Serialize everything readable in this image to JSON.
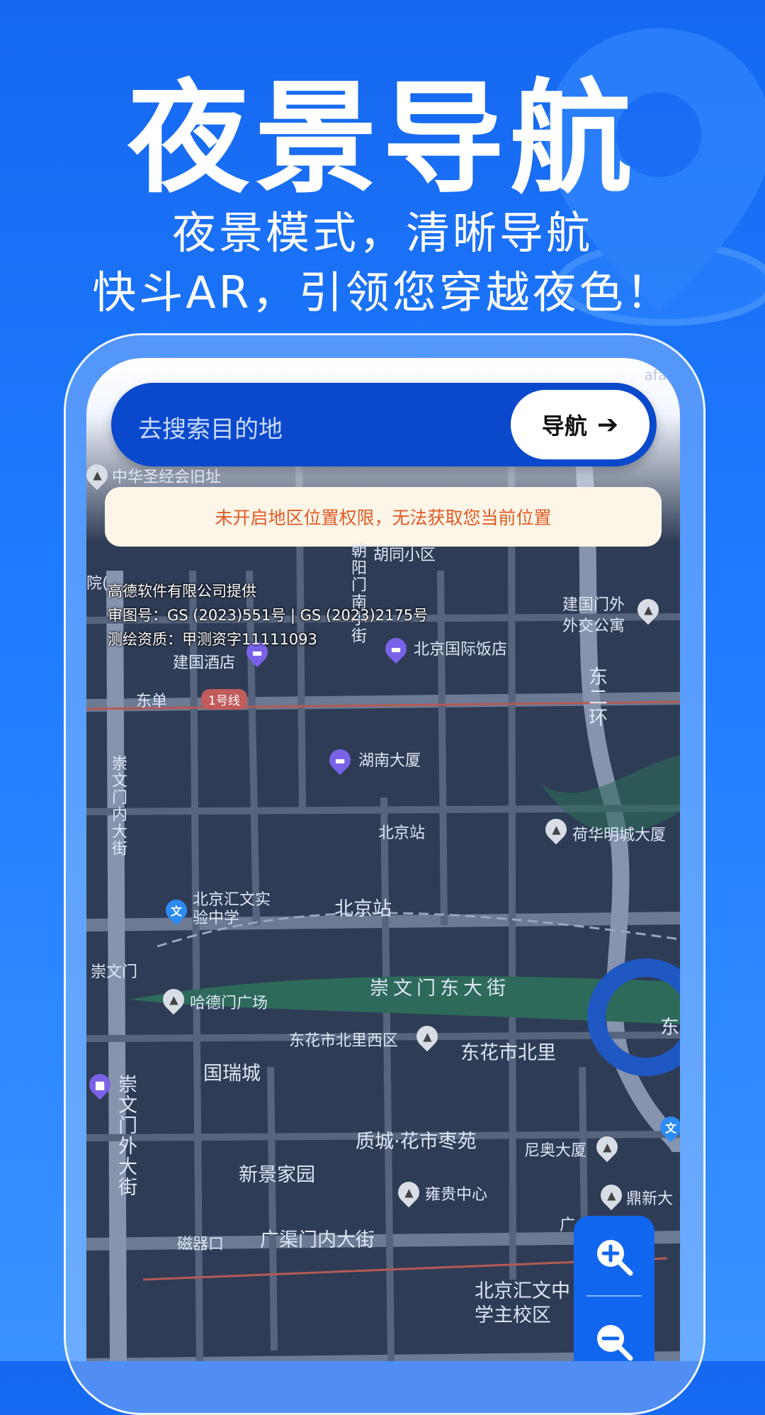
{
  "hero": {
    "title": "夜景导航",
    "subtitle_line1": "夜景模式，清晰导航",
    "subtitle_line2": "快斗AR，引领您穿越夜色！"
  },
  "search": {
    "placeholder": "去搜索目的地",
    "nav_label": "导航",
    "nav_icon": "arrow-right-icon"
  },
  "watermark": "afac",
  "notice": "未开启地区位置权限，无法获取您当前位置",
  "attribution": {
    "line1": "高德软件有限公司提供",
    "line2": "审图号：GS (2023)551号 | GS (2023)2175号",
    "line3": "测绘资质：甲测资字11111093"
  },
  "map_labels": {
    "zhonghua": "中华圣经会旧址",
    "yuan": "院(",
    "hutong": "胡同小区",
    "chaoyangmen": "朝阳门南小街",
    "jianguomenwai": "建国门外",
    "waijiao": "外交公寓",
    "beijing_guoji": "北京国际饭店",
    "jianguo_hotel": "建国酒店",
    "dongdan": "东单",
    "line1": "1号线",
    "dong_erhuan": "东二环",
    "hunan": "湖南大厦",
    "chongwenmen_nei": "崇文门内大街",
    "beijingzhan_road": "北京站",
    "hehua": "荷华明城大厦",
    "huiwen": "北京汇文实验中学",
    "beijingzhan": "北京站",
    "chongwenmen": "崇文门",
    "chongwenmen_dong": "崇文门东大街",
    "hademen": "哈德门广场",
    "dongshi_xiqu": "东花市北里西区",
    "dongshi_beili": "东花市北里",
    "guorui": "国瑞城",
    "chongwenmen_wai": "崇文门外大街",
    "zhicheng": "质城·花市枣苑",
    "niao": "尼奥大厦",
    "xinjing": "新景家园",
    "yonggui": "雍贵中心",
    "dingxin": "鼎新大",
    "ciqikou": "磁器口",
    "guangqumen": "广渠门内大街",
    "huiwen_school": "北京汇文中学主校区",
    "guang": "广",
    "dong": "东"
  }
}
